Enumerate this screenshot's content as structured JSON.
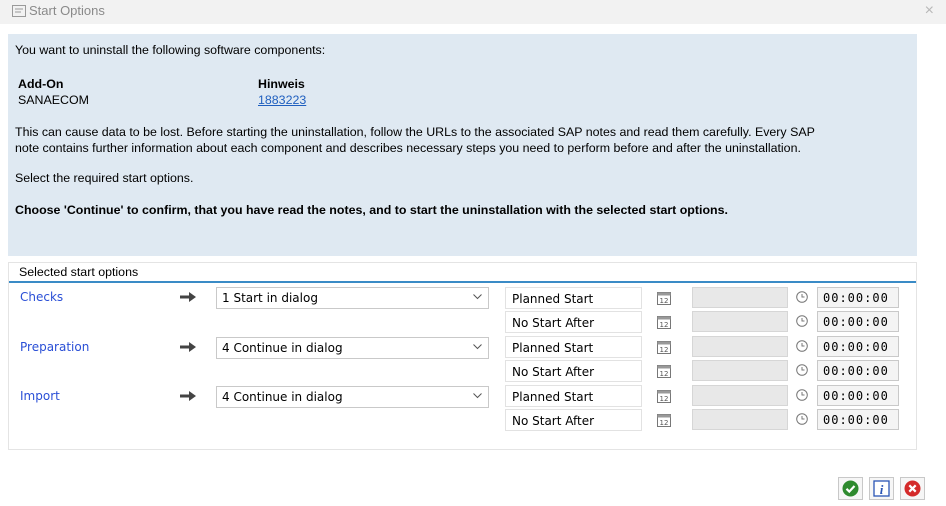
{
  "window": {
    "title": "Start Options",
    "title_icon": "dialog-icon",
    "close_glyph": "×"
  },
  "info": {
    "intro": "You want to uninstall the following software components:",
    "col_addon": "Add-On",
    "col_note": "Hinweis",
    "addon": "SANAECOM",
    "note": "1883223",
    "warning_line1": "This can cause data to be lost. Before starting the uninstallation, follow the URLs to the associated SAP notes and read them carefully. Every SAP",
    "warning_line2": "note contains further information about each component and describes necessary steps you need to perform before and after the uninstallation.",
    "select_text": "Select the required start options.",
    "confirm_text": "Choose 'Continue' to confirm, that you have read the notes, and to start the uninstallation with the selected start options."
  },
  "options": {
    "header": "Selected start options",
    "steps": [
      {
        "label": "Checks",
        "value": "1 Start in dialog",
        "planned_start_label": "Planned Start",
        "no_start_after_label": "No Start After",
        "planned_time": "00:00:00",
        "after_time": "00:00:00"
      },
      {
        "label": "Preparation",
        "value": "4 Continue in dialog",
        "planned_start_label": "Planned Start",
        "no_start_after_label": "No Start After",
        "planned_time": "00:00:00",
        "after_time": "00:00:00"
      },
      {
        "label": "Import",
        "value": "4 Continue in dialog",
        "planned_start_label": "Planned Start",
        "no_start_after_label": "No Start After",
        "planned_time": "00:00:00",
        "after_time": "00:00:00"
      }
    ]
  },
  "footer": {
    "buttons": [
      "continue-icon",
      "info-icon",
      "cancel-icon"
    ]
  },
  "colors": {
    "info_bg": "#dfe9f2",
    "link": "#1f5fbf",
    "step_label": "#2a4fd6",
    "header_line": "#3a8bc6",
    "continue_green": "#2e8a2e",
    "cancel_red": "#d42a2a",
    "info_blue": "#2a55b5"
  }
}
